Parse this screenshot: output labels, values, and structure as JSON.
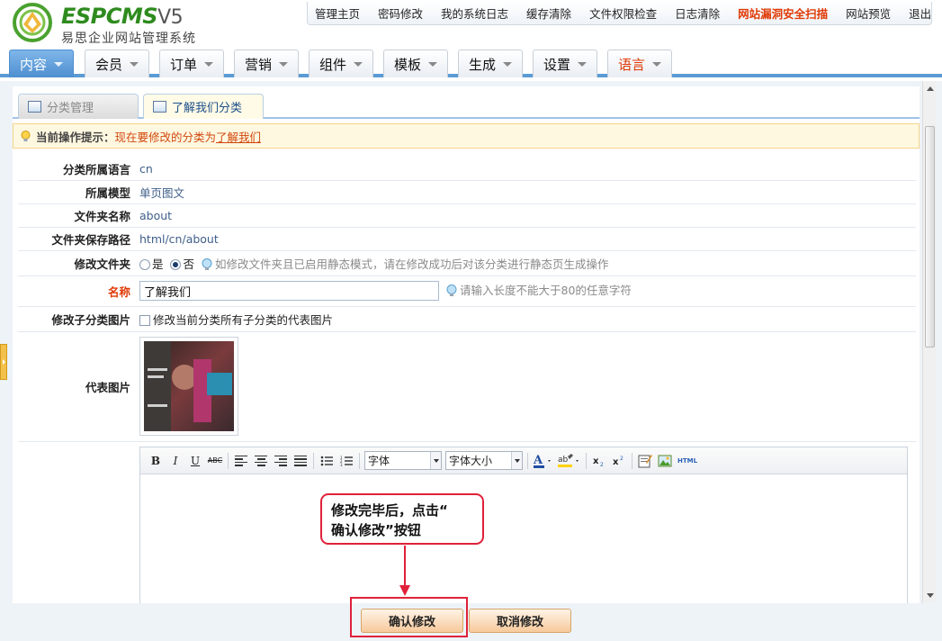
{
  "brand": {
    "name": "ESPCMS",
    "version": "V5",
    "subtitle": "易思企业网站管理系统"
  },
  "topnav": [
    {
      "label": "管理主页",
      "hot": false
    },
    {
      "label": "密码修改",
      "hot": false
    },
    {
      "label": "我的系统日志",
      "hot": false
    },
    {
      "label": "缓存清除",
      "hot": false
    },
    {
      "label": "文件权限检查",
      "hot": false
    },
    {
      "label": "日志清除",
      "hot": false
    },
    {
      "label": "网站漏洞安全扫描",
      "hot": true
    },
    {
      "label": "网站预览",
      "hot": false
    },
    {
      "label": "退出",
      "hot": false
    }
  ],
  "mainnav": [
    {
      "label": "内容",
      "active": true
    },
    {
      "label": "会员",
      "active": false
    },
    {
      "label": "订单",
      "active": false
    },
    {
      "label": "营销",
      "active": false
    },
    {
      "label": "组件",
      "active": false
    },
    {
      "label": "模板",
      "active": false
    },
    {
      "label": "生成",
      "active": false
    },
    {
      "label": "设置",
      "active": false
    },
    {
      "label": "语言",
      "active": false
    }
  ],
  "subtabs": {
    "manage": "分类管理",
    "current": "了解我们分类"
  },
  "hint": {
    "label": "当前操作提示：",
    "text": "现在要修改的分类为 ",
    "link": "了解我们"
  },
  "form": {
    "lang_label": "分类所属语言",
    "lang_value": "cn",
    "model_label": "所属模型",
    "model_value": "单页图文",
    "folder_label": "文件夹名称",
    "folder_value": "about",
    "path_label": "文件夹保存路径",
    "path_value": "html/cn/about",
    "modify_folder_label": "修改文件夹",
    "yes_label": "是",
    "no_label": "否",
    "modify_folder_hint": "如修改文件夹且已启用静态模式，请在修改成功后对该分类进行静态页生成操作",
    "modify_folder_selected": "否",
    "name_label": "名称",
    "name_value": "了解我们",
    "name_hint": "请输入长度不能大于80的任意字符",
    "child_img_label": "修改子分类图片",
    "child_img_text": "修改当前分类所有子分类的代表图片",
    "rep_img_label": "代表图片"
  },
  "editor": {
    "font_family": "字体",
    "font_size": "字体大小",
    "html_label": "HTML",
    "bold": "B",
    "italic": "I",
    "underline": "U",
    "strike": "ABC"
  },
  "callout": {
    "line1": "修改完毕后，点击“",
    "line2": "确认修改”按钮"
  },
  "buttons": {
    "confirm": "确认修改",
    "cancel": "取消修改"
  },
  "colors": {
    "accent": "#5b9bd5",
    "hot": "#e03a06",
    "brand_green": "#2e8b1e",
    "callout_red": "#e0213a"
  }
}
